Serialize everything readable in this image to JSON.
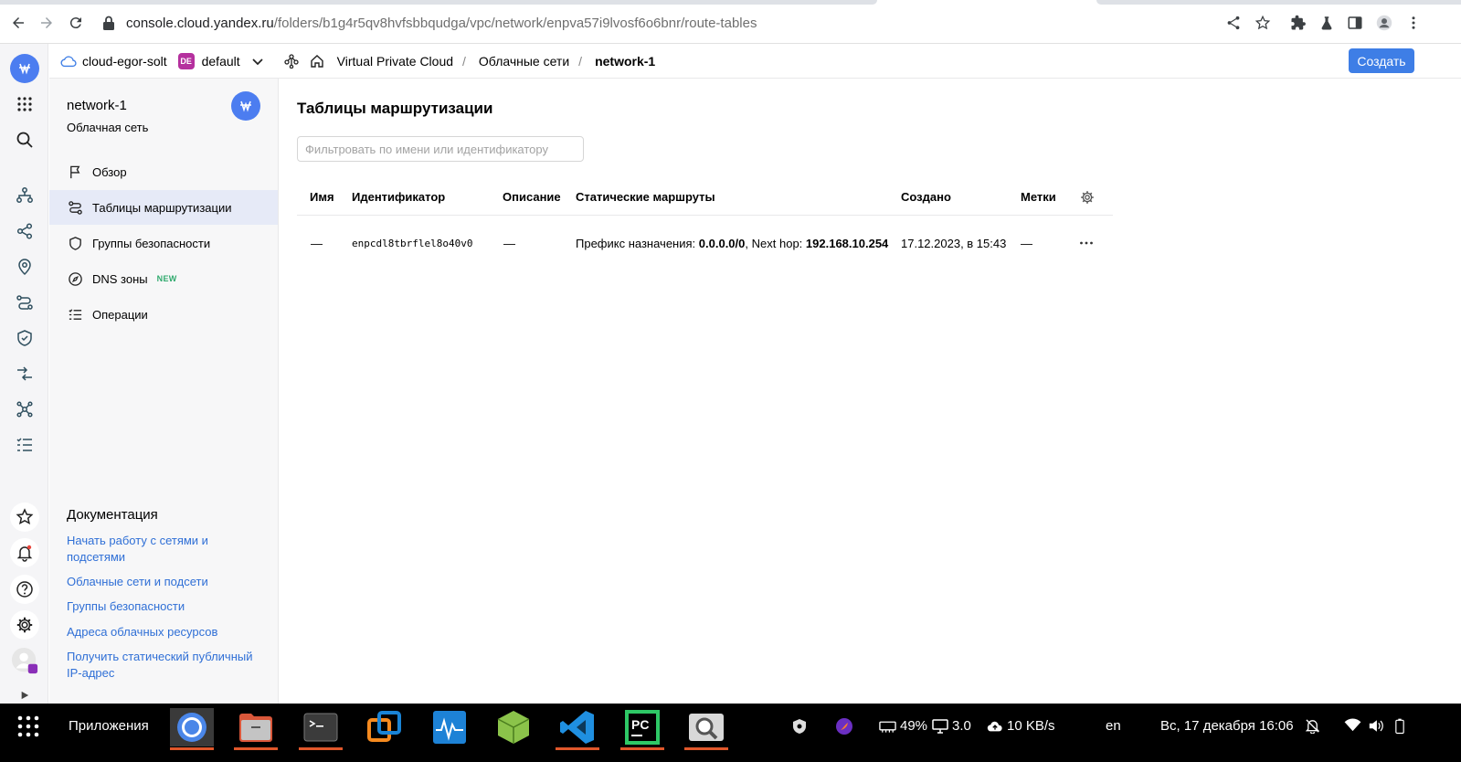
{
  "browser": {
    "url_host": "console.cloud.yandex.ru",
    "url_path": "/folders/b1g4r5qv8hvfsbbqudga/vpc/network/enpva57i9lvosf6o6bnr/route-tables"
  },
  "header": {
    "cloud_name": "cloud-egor-solt",
    "folder_badge": "DE",
    "folder_name": "default",
    "breadcrumbs": [
      "Virtual Private Cloud",
      "Облачные сети",
      "network-1"
    ],
    "separator": "/",
    "create_label": "Создать"
  },
  "sidebar": {
    "resource_title": "network-1",
    "resource_subtitle": "Облачная сеть",
    "menu": [
      {
        "label": "Обзор",
        "icon": "flag-icon"
      },
      {
        "label": "Таблицы маршрутизации",
        "icon": "route-icon",
        "active": true
      },
      {
        "label": "Группы безопасности",
        "icon": "shield-icon"
      },
      {
        "label": "DNS зоны",
        "icon": "dns-icon",
        "badge": "NEW"
      },
      {
        "label": "Операции",
        "icon": "list-icon"
      }
    ],
    "docs_title": "Документация",
    "docs": [
      "Начать работу с сетями и подсетями",
      "Облачные сети и подсети",
      "Группы безопасности",
      "Адреса облачных ресурсов",
      "Получить статический публичный IP-адрес"
    ]
  },
  "main": {
    "title": "Таблицы маршрутизации",
    "filter_placeholder": "Фильтровать по имени или идентификатору",
    "columns": [
      "Имя",
      "Идентификатор",
      "Описание",
      "Статические маршруты",
      "Создано",
      "Метки"
    ],
    "rows": [
      {
        "name": "—",
        "id": "enpcdl8tbrflel8o40v0",
        "description": "—",
        "route_prefix_label": "Префикс назначения:",
        "route_prefix": "0.0.0.0/0",
        "route_sep": ",",
        "route_hop_label": "Next hop:",
        "route_hop": "192.168.10.254",
        "created": "17.12.2023, в 15:43",
        "labels": "—"
      }
    ]
  },
  "taskbar": {
    "apps_label": "Приложения",
    "battery": "49%",
    "load": "3.0",
    "net": "10 KB/s",
    "lang": "en",
    "datetime": "Вс, 17 декабря  16:06"
  },
  "colors": {
    "accent": "#3e7ee6",
    "logo": "#4c7df0",
    "folder_badge": "#b5309e",
    "link": "#2f6fd6",
    "new_badge": "#30aa6e"
  }
}
